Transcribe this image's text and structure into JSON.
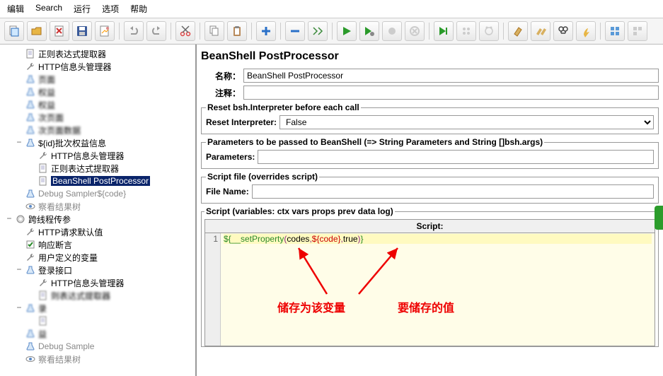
{
  "menus": [
    "编辑",
    "Search",
    "运行",
    "选项",
    "帮助"
  ],
  "tree": [
    {
      "pad": 18,
      "tog": "",
      "ico": "doc",
      "txt": "正则表达式提取器"
    },
    {
      "pad": 18,
      "tog": "",
      "ico": "wrench",
      "txt": "HTTP信息头管理器"
    },
    {
      "pad": 18,
      "tog": "",
      "ico": "flask",
      "txt": "       页面",
      "blur": true
    },
    {
      "pad": 18,
      "tog": "",
      "ico": "flask",
      "txt": "    权益",
      "blur": true
    },
    {
      "pad": 18,
      "tog": "",
      "ico": "flask",
      "txt": "     权益",
      "blur": true
    },
    {
      "pad": 18,
      "tog": "",
      "ico": "flask",
      "txt": "    次页面",
      "blur": true
    },
    {
      "pad": 18,
      "tog": "",
      "ico": "flask",
      "txt": "    次页面数据",
      "blur": true
    },
    {
      "pad": 18,
      "tog": "−",
      "ico": "flask",
      "txt": "${id}批次权益信息"
    },
    {
      "pad": 36,
      "tog": "",
      "ico": "wrench",
      "txt": "HTTP信息头管理器"
    },
    {
      "pad": 36,
      "tog": "",
      "ico": "doc",
      "txt": "正则表达式提取器"
    },
    {
      "pad": 36,
      "tog": "",
      "ico": "doc",
      "txt": "BeanShell PostProcessor",
      "sel": true
    },
    {
      "pad": 18,
      "tog": "",
      "ico": "flask",
      "txt": "Debug Sampler${code}",
      "faded": true
    },
    {
      "pad": 18,
      "tog": "",
      "ico": "eye",
      "txt": "察看结果树",
      "faded": true
    },
    {
      "pad": 4,
      "tog": "−",
      "ico": "gear",
      "txt": "跨线程传参"
    },
    {
      "pad": 18,
      "tog": "",
      "ico": "wrench",
      "txt": "HTTP请求默认值"
    },
    {
      "pad": 18,
      "tog": "",
      "ico": "check",
      "txt": "响应断言"
    },
    {
      "pad": 18,
      "tog": "",
      "ico": "wrench",
      "txt": "用户定义的变量"
    },
    {
      "pad": 18,
      "tog": "−",
      "ico": "flask",
      "txt": "登录接口"
    },
    {
      "pad": 36,
      "tog": "",
      "ico": "wrench",
      "txt": "HTTP信息头管理器"
    },
    {
      "pad": 36,
      "tog": "",
      "ico": "doc",
      "txt": "    则表达式提取器",
      "blur": true
    },
    {
      "pad": 18,
      "tog": "−",
      "ico": "flask",
      "txt": "   录",
      "blur": true
    },
    {
      "pad": 36,
      "tog": "",
      "ico": "doc",
      "txt": "       ",
      "blur": true
    },
    {
      "pad": 18,
      "tog": "",
      "ico": "flask",
      "txt": "   益",
      "blur": true
    },
    {
      "pad": 18,
      "tog": "",
      "ico": "flask",
      "txt": "Debug Sample",
      "faded": true
    },
    {
      "pad": 18,
      "tog": "",
      "ico": "eye",
      "txt": "察看结果树",
      "faded": true
    }
  ],
  "title": "BeanShell PostProcessor",
  "name_label": "名称：",
  "name_value": "BeanShell PostProcessor",
  "comment_label": "注释：",
  "comment_value": "",
  "reset_legend": "Reset bsh.Interpreter before each call",
  "reset_label": "Reset Interpreter:",
  "reset_value": "False",
  "params_legend": "Parameters to be passed to BeanShell (=> String Parameters and String []bsh.args)",
  "params_label": "Parameters:",
  "params_value": "",
  "file_legend": "Script file (overrides script)",
  "file_label": "File Name:",
  "file_value": "",
  "script_legend": "Script (variables: ctx vars props prev data log)",
  "script_header": "Script:",
  "line_no": "1",
  "tok": {
    "d1": "${",
    "fn": "__setProperty",
    "p1": "(",
    "a1": "codes",
    ",": ",",
    "dv": "${",
    "v": "code",
    "de": "}",
    "a3": "true",
    "p2": ")",
    "d2": "}"
  },
  "annot1": "储存为该变量",
  "annot2": "要储存的值"
}
